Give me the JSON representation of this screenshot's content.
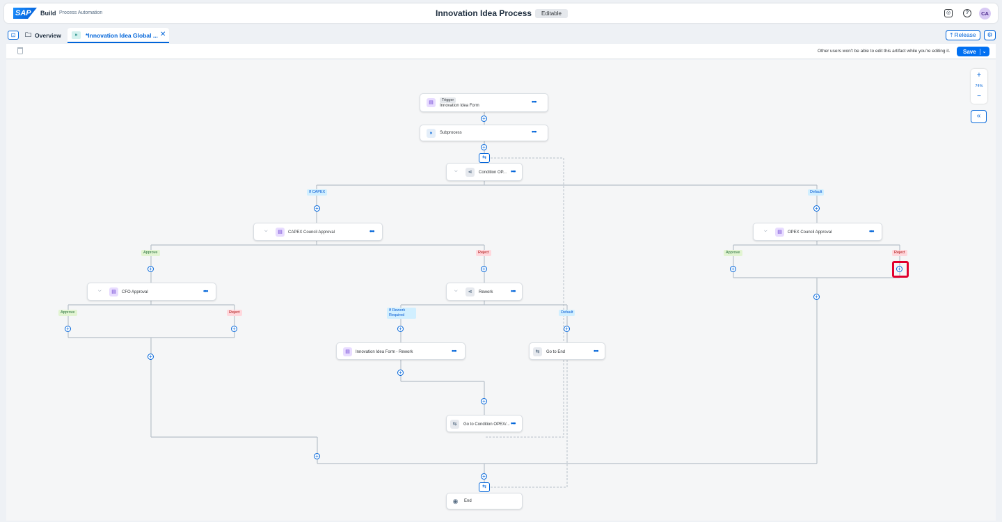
{
  "shell": {
    "logo": "SAP",
    "product": "Build",
    "subproduct": "Process Automation",
    "title": "Innovation Idea Process",
    "status_badge": "Editable",
    "avatar": "CA"
  },
  "tabs": {
    "overview": "Overview",
    "active": "*Innovation Idea Global ...",
    "release": "Release"
  },
  "toolbar": {
    "message": "Other users won't be able to edit this artifact while you're editing it.",
    "save": "Save"
  },
  "zoom": {
    "level": "74%",
    "plus": "+",
    "minus": "−"
  },
  "nodes": {
    "trigger_tag": "Trigger",
    "trigger_name": "Innovation Idea Form",
    "subprocess": "Subprocess",
    "condition": "Condition OP...",
    "capex": "CAPEX Council Approval",
    "opex": "OPEX Council Approval",
    "cfo": "CFO Approval",
    "rework": "Rework",
    "rework_form": "Innovation Idea Form - Rework",
    "go_end": "Go to End",
    "go_condition": "Go to Condition OPEX/...",
    "end": "End"
  },
  "labels": {
    "if_capex": "If CAPEX",
    "default": "Default",
    "approve": "Approve",
    "reject": "Reject",
    "if_rework_line1": "If Rework",
    "if_rework_line2": "Required"
  },
  "colors": {
    "accent": "#0064d9",
    "highlight": "#e1002e"
  }
}
